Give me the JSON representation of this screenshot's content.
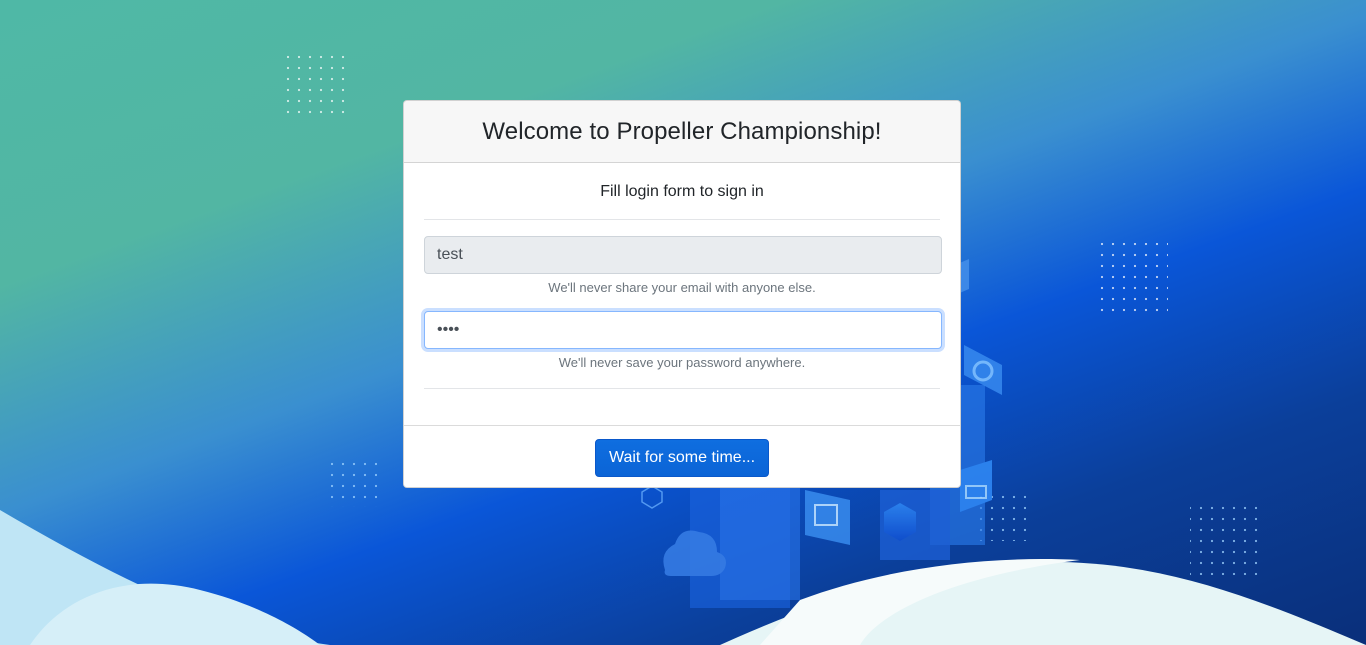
{
  "card": {
    "title": "Welcome to Propeller Championship!",
    "subtitle": "Fill login form to sign in",
    "username": {
      "value": "test",
      "help": "We'll never share your email with anyone else."
    },
    "password": {
      "value": "test",
      "help": "We'll never save your password anywhere."
    },
    "submit_label": "Wait for some time..."
  },
  "colors": {
    "primary_button": "#0d6efd",
    "background_teal": "#52b6a3",
    "background_blue": "#0a56d8"
  }
}
